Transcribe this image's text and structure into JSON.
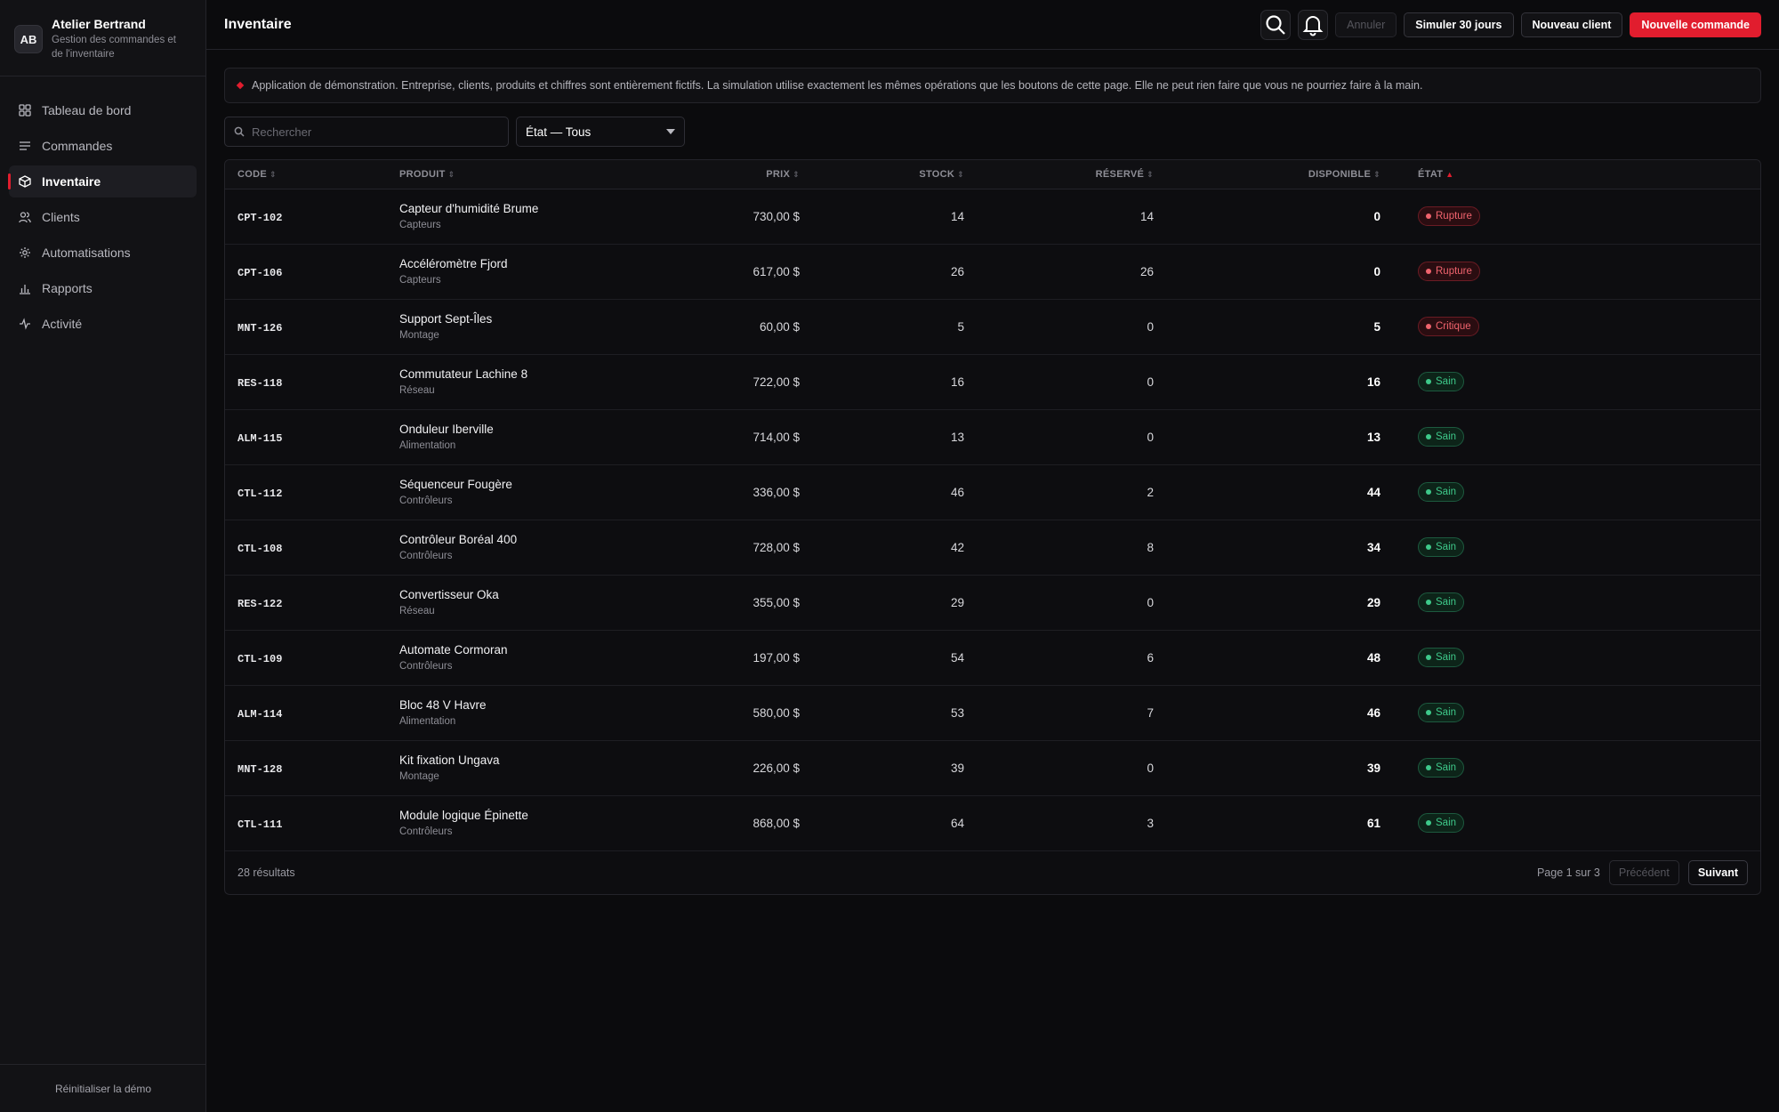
{
  "brand": {
    "initials": "AB",
    "name": "Atelier Bertrand",
    "subtitle": "Gestion des commandes et de l'inventaire"
  },
  "sidebar": {
    "items": [
      {
        "label": "Tableau de bord",
        "icon": "dashboard-icon"
      },
      {
        "label": "Commandes",
        "icon": "list-icon"
      },
      {
        "label": "Inventaire",
        "icon": "box-icon",
        "active": true
      },
      {
        "label": "Clients",
        "icon": "users-icon"
      },
      {
        "label": "Automatisations",
        "icon": "automation-icon"
      },
      {
        "label": "Rapports",
        "icon": "chart-icon"
      },
      {
        "label": "Activité",
        "icon": "activity-icon"
      }
    ],
    "footer": "Réinitialiser la démo"
  },
  "header": {
    "title": "Inventaire",
    "undo_label": "Annuler",
    "simulate_label": "Simuler 30 jours",
    "new_client_label": "Nouveau client",
    "new_order_label": "Nouvelle commande"
  },
  "notice": "Application de démonstration. Entreprise, clients, produits et chiffres sont entièrement fictifs. La simulation utilise exactement les mêmes opérations que les boutons de cette page. Elle ne peut rien faire que vous ne pourriez faire à la main.",
  "filters": {
    "search_placeholder": "Rechercher",
    "search_value": "",
    "state_selected": "État — Tous"
  },
  "table": {
    "columns": [
      "CODE",
      "PRODUIT",
      "PRIX",
      "STOCK",
      "RÉSERVÉ",
      "DISPONIBLE",
      "ÉTAT"
    ],
    "rows": [
      {
        "code": "CPT-102",
        "name": "Capteur d'humidité Brume",
        "category": "Capteurs",
        "price": "730,00 $",
        "stock": "14",
        "reserved": "14",
        "available": "0",
        "state": "Rupture",
        "tone": "red"
      },
      {
        "code": "CPT-106",
        "name": "Accéléromètre Fjord",
        "category": "Capteurs",
        "price": "617,00 $",
        "stock": "26",
        "reserved": "26",
        "available": "0",
        "state": "Rupture",
        "tone": "red"
      },
      {
        "code": "MNT-126",
        "name": "Support Sept-Îles",
        "category": "Montage",
        "price": "60,00 $",
        "stock": "5",
        "reserved": "0",
        "available": "5",
        "state": "Critique",
        "tone": "red"
      },
      {
        "code": "RES-118",
        "name": "Commutateur Lachine 8",
        "category": "Réseau",
        "price": "722,00 $",
        "stock": "16",
        "reserved": "0",
        "available": "16",
        "state": "Sain",
        "tone": "green"
      },
      {
        "code": "ALM-115",
        "name": "Onduleur Iberville",
        "category": "Alimentation",
        "price": "714,00 $",
        "stock": "13",
        "reserved": "0",
        "available": "13",
        "state": "Sain",
        "tone": "green"
      },
      {
        "code": "CTL-112",
        "name": "Séquenceur Fougère",
        "category": "Contrôleurs",
        "price": "336,00 $",
        "stock": "46",
        "reserved": "2",
        "available": "44",
        "state": "Sain",
        "tone": "green"
      },
      {
        "code": "CTL-108",
        "name": "Contrôleur Boréal 400",
        "category": "Contrôleurs",
        "price": "728,00 $",
        "stock": "42",
        "reserved": "8",
        "available": "34",
        "state": "Sain",
        "tone": "green"
      },
      {
        "code": "RES-122",
        "name": "Convertisseur Oka",
        "category": "Réseau",
        "price": "355,00 $",
        "stock": "29",
        "reserved": "0",
        "available": "29",
        "state": "Sain",
        "tone": "green"
      },
      {
        "code": "CTL-109",
        "name": "Automate Cormoran",
        "category": "Contrôleurs",
        "price": "197,00 $",
        "stock": "54",
        "reserved": "6",
        "available": "48",
        "state": "Sain",
        "tone": "green"
      },
      {
        "code": "ALM-114",
        "name": "Bloc 48 V Havre",
        "category": "Alimentation",
        "price": "580,00 $",
        "stock": "53",
        "reserved": "7",
        "available": "46",
        "state": "Sain",
        "tone": "green"
      },
      {
        "code": "MNT-128",
        "name": "Kit fixation Ungava",
        "category": "Montage",
        "price": "226,00 $",
        "stock": "39",
        "reserved": "0",
        "available": "39",
        "state": "Sain",
        "tone": "green"
      },
      {
        "code": "CTL-111",
        "name": "Module logique Épinette",
        "category": "Contrôleurs",
        "price": "868,00 $",
        "stock": "64",
        "reserved": "3",
        "available": "61",
        "state": "Sain",
        "tone": "green"
      }
    ],
    "result_count": "28 résultats",
    "page_info": "Page 1 sur 3",
    "prev_label": "Précédent",
    "next_label": "Suivant"
  },
  "colors": {
    "accent": "#e11d2e",
    "danger": "#f0636d",
    "success": "#3ec98a"
  }
}
